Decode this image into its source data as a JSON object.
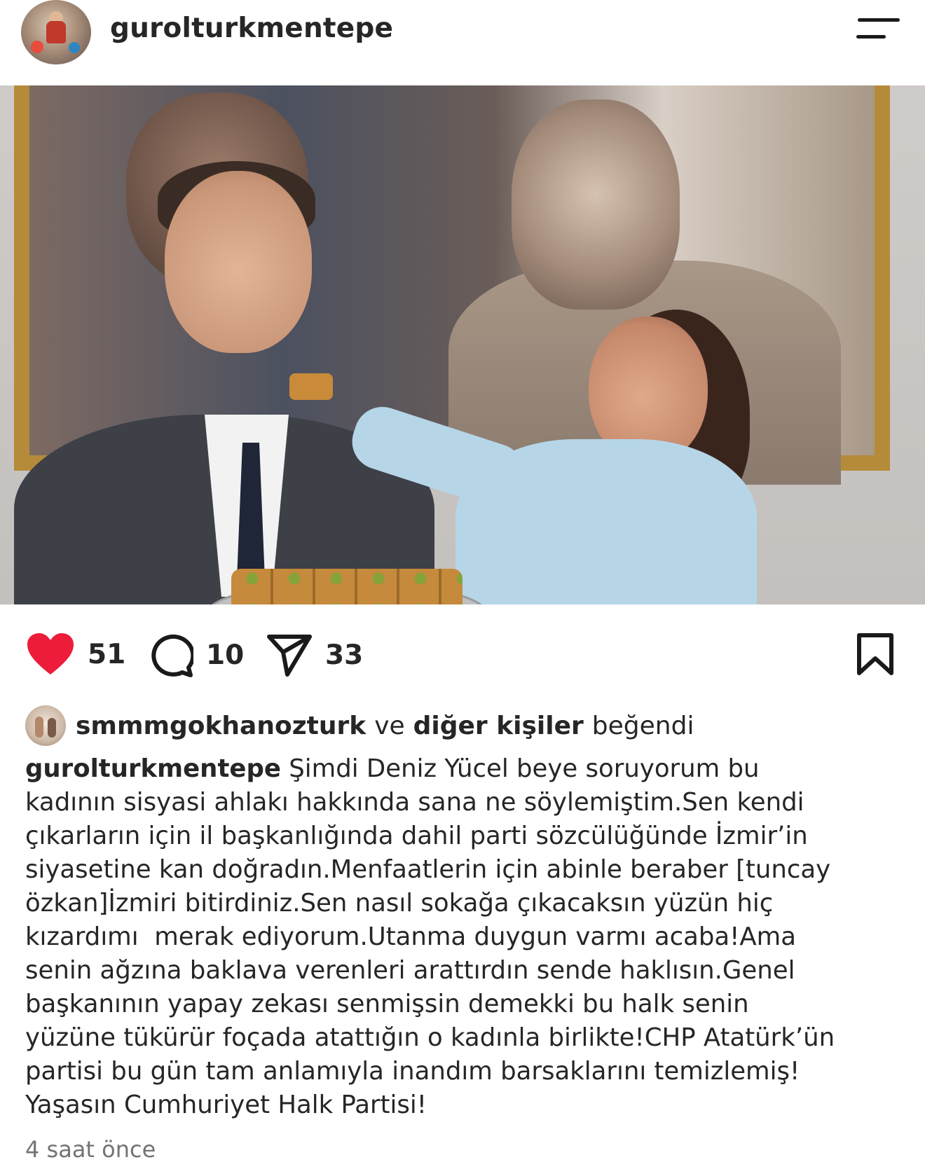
{
  "header": {
    "username": "gurolturkmentepe",
    "avatar_icon": "profile-avatar",
    "menu_icon": "menu-icon"
  },
  "post_image": {
    "description_icon": "post-photo"
  },
  "actions": {
    "like_count": "51",
    "comment_count": "10",
    "share_count": "33",
    "like_color": "#ed1c3a"
  },
  "likes": {
    "user": "smmmgokhanozturk",
    "connector": "ve",
    "others": "diğer kişiler",
    "suffix": "beğendi"
  },
  "caption": {
    "username": "gurolturkmentepe",
    "text": " Şimdi Deniz Yücel beye soruyorum bu\nkadının sisyasi ahlakı hakkında sana ne söylemiştim.Sen kendi\nçıkarların için il başkanlığında dahil parti sözcülüğünde İzmir’in\nsiyasetine kan doğradın.Menfaatlerin için abinle beraber [tuncay\nözkan]İzmiri bitirdiniz.Sen nasıl sokağa çıkacaksın yüzün hiç\nkızardımı  merak ediyorum.Utanma duygun varmı acaba!Ama\nsenin ağzına baklava verenleri arattırdın sende haklısın.Genel\nbaşkanının yapay zekası senmişsin demekki bu halk senin\nyüzüne tükürür foçada atattığın o kadınla birlikte!CHP Atatürk’ün\npartisi bu gün tam anlamıyla inandım barsaklarını temizlemiş!\nYaşasın Cumhuriyet Halk Partisi!"
  },
  "timestamp": "4 saat önce"
}
